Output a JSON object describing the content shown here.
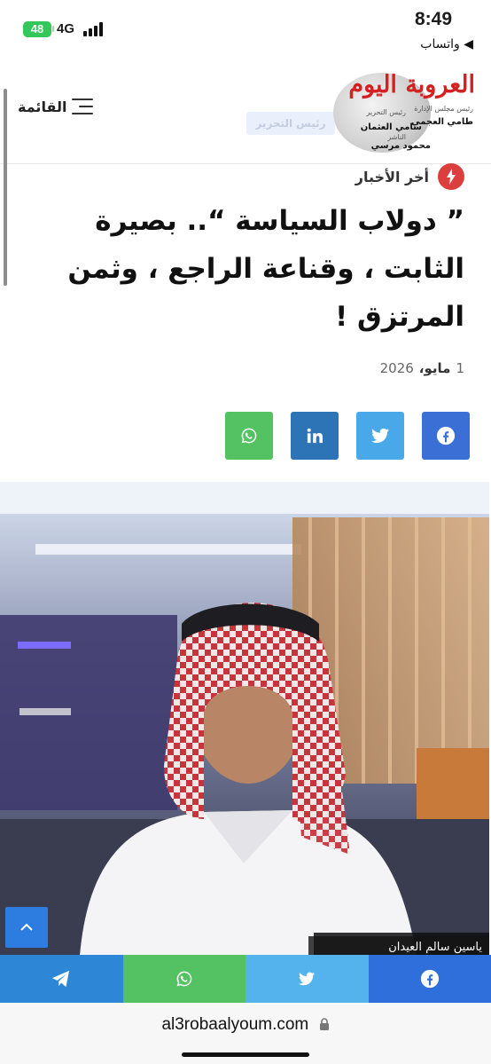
{
  "status_bar": {
    "time": "8:49",
    "back_app": "◀ واتساب",
    "battery": "48",
    "network": "4G"
  },
  "header": {
    "menu_label": "القائمة",
    "logo": {
      "title": "العروبة اليوم",
      "board_chair_label": "رئيس مجلس الإدارة",
      "board_chair_name": "طامي العجمي",
      "editor_label": "رئيس التحرير",
      "editor_name": "سامي العثمان",
      "publisher_label": "الناشر",
      "publisher_name": "محمود مرسي"
    },
    "editor_badge": "رئيس التحرير"
  },
  "article": {
    "category": "أخر الأخبار",
    "title": "” دولاب السياسة “.. بصيرة الثابت ، وقناعة الراجع ، وثمن المرتزق !",
    "date_day": "1",
    "date_month": "مايو،",
    "date_year": "2026",
    "photo_caption": "ياسين سالم العيدان"
  },
  "share_buttons": [
    {
      "network": "facebook",
      "icon": "facebook-icon",
      "color": "#3b6fd6"
    },
    {
      "network": "twitter",
      "icon": "twitter-icon",
      "color": "#48a8e8"
    },
    {
      "network": "linkedin",
      "icon": "linkedin-icon",
      "color": "#2d74b6"
    },
    {
      "network": "whatsapp",
      "icon": "whatsapp-icon",
      "color": "#54c262"
    }
  ],
  "bottom_share": [
    {
      "network": "telegram",
      "icon": "telegram-icon",
      "color": "#2e86d6"
    },
    {
      "network": "whatsapp",
      "icon": "whatsapp-icon",
      "color": "#54c262"
    },
    {
      "network": "twitter",
      "icon": "twitter-icon",
      "color": "#54b2ec"
    },
    {
      "network": "facebook",
      "icon": "facebook-icon",
      "color": "#2f6fdb"
    }
  ],
  "browser": {
    "url": "al3robaalyoum.com"
  },
  "colors": {
    "accent_red": "#dc3d3d",
    "logo_red": "#d42020",
    "back_to_top": "#2d7de0"
  }
}
